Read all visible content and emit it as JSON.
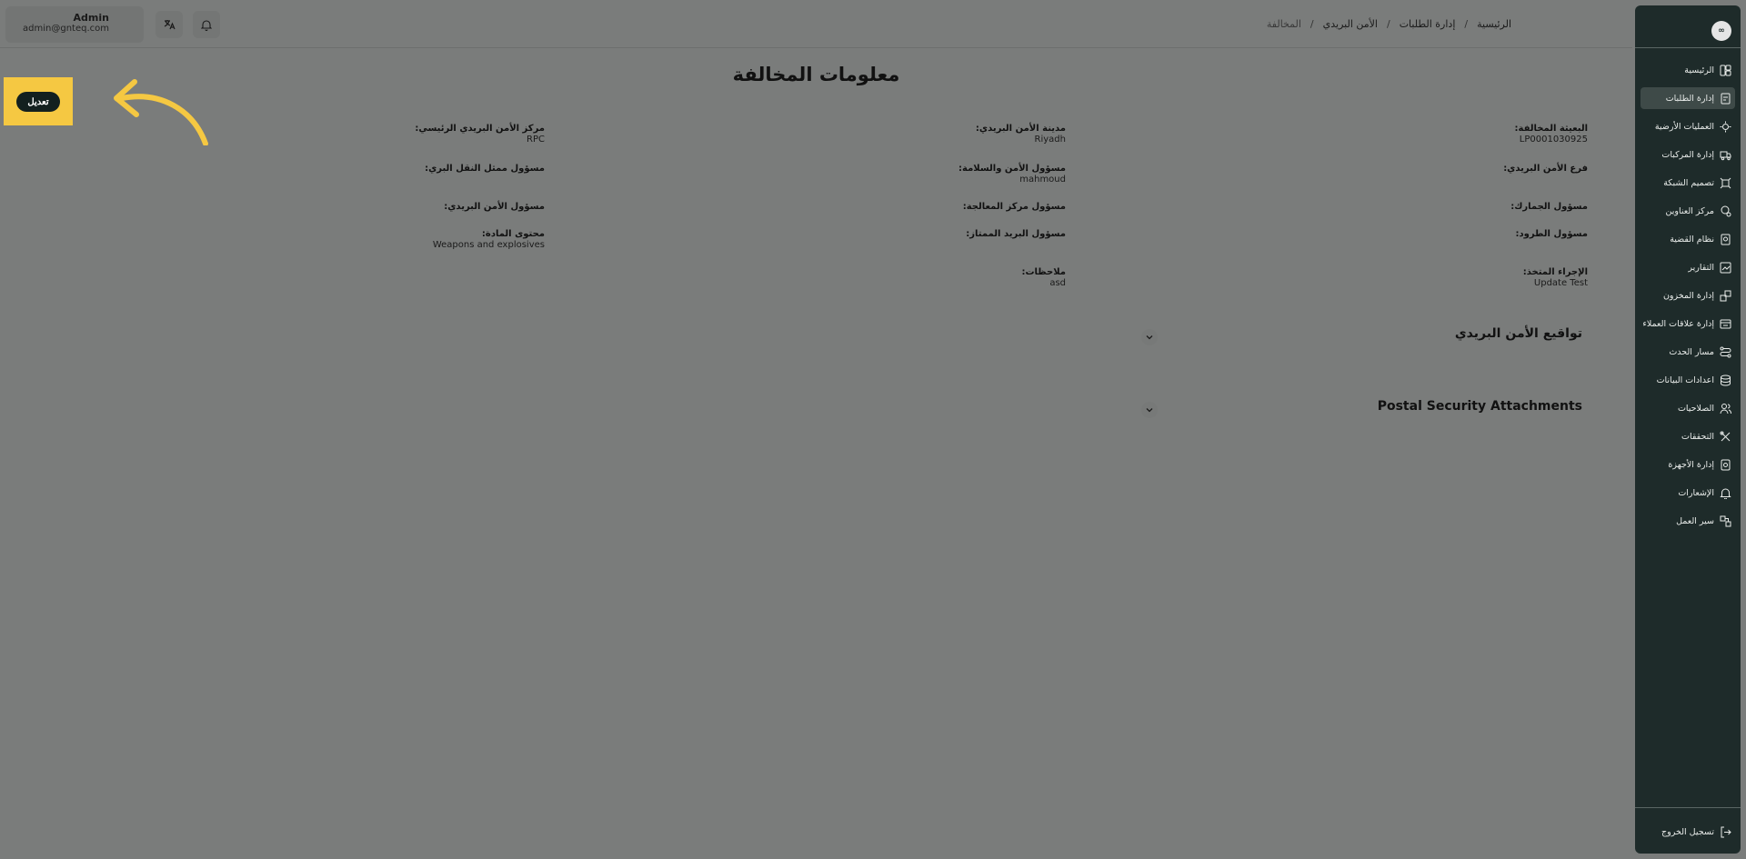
{
  "header": {
    "user_name": "Admin",
    "user_email": "admin@gnteq.com",
    "breadcrumb": [
      "الرئيسية",
      "إدارة الطلبات",
      "الأمن البريدي",
      "المخالفة"
    ],
    "translate_icon": "translate-icon",
    "bell_icon": "bell-icon"
  },
  "sidebar": {
    "logo_text": "∞",
    "items": [
      {
        "label": "الرئيسية",
        "icon": "dashboard-icon"
      },
      {
        "label": "إدارة الطلبات",
        "icon": "requests-icon"
      },
      {
        "label": "العمليات الأرضية",
        "icon": "ground-ops-icon"
      },
      {
        "label": "إدارة المركبات",
        "icon": "truck-icon"
      },
      {
        "label": "تصميم الشبكة",
        "icon": "network-icon"
      },
      {
        "label": "مركز العناوين",
        "icon": "location-icon"
      },
      {
        "label": "نظام القضية",
        "icon": "case-icon"
      },
      {
        "label": "التقارير",
        "icon": "reports-icon"
      },
      {
        "label": "إدارة المخزون",
        "icon": "inventory-icon"
      },
      {
        "label": "إدارة علاقات العملاء",
        "icon": "crm-icon"
      },
      {
        "label": "مسار الحدث",
        "icon": "route-icon"
      },
      {
        "label": "اعدادات البيانات",
        "icon": "database-icon"
      },
      {
        "label": "الصلاحيات",
        "icon": "users-icon"
      },
      {
        "label": "التحققات",
        "icon": "tools-icon"
      },
      {
        "label": "إدارة الأجهزة",
        "icon": "device-icon"
      },
      {
        "label": "الإشعارات",
        "icon": "bell-icon"
      },
      {
        "label": "سير العمل",
        "icon": "workflow-icon"
      }
    ],
    "logout_label": "تسجيل الخروج"
  },
  "main": {
    "title": "معلومات المخالفة",
    "edit_label": "تعديل",
    "fields": {
      "violation_entity": {
        "label": "البعيثة المخالفة:",
        "value": "LP0001030925"
      },
      "security_city": {
        "label": "مدينة الأمن البريدي:",
        "value": "Riyadh"
      },
      "main_center": {
        "label": "مركز الأمن البريدي الرئيسي:",
        "value": "RPC"
      },
      "security_branch": {
        "label": "فرع الأمن البريدي:",
        "value": ""
      },
      "safety_officer": {
        "label": "مسؤول الأمن والسلامة:",
        "value": "mahmoud"
      },
      "land_transport_officer": {
        "label": "مسؤول ممثل النقل البري:",
        "value": ""
      },
      "customs_officer": {
        "label": "مسؤول الجمارك:",
        "value": ""
      },
      "processing_officer": {
        "label": "مسؤول مركز المعالجة:",
        "value": ""
      },
      "security_officer": {
        "label": "مسؤول الأمن البريدي:",
        "value": ""
      },
      "parcels_officer": {
        "label": "مسؤول الطرود:",
        "value": ""
      },
      "premium_officer": {
        "label": "مسؤول البريد الممتاز:",
        "value": ""
      },
      "material_content": {
        "label": "محتوى المادة:",
        "value": "Weapons and explosives"
      },
      "action_taken": {
        "label": "الإجراء المتخذ:",
        "value": "Update Test"
      },
      "notes": {
        "label": "ملاحظات:",
        "value": "asd"
      }
    },
    "sections": [
      {
        "title": "تواقيع الأمن البريدي"
      },
      {
        "title": "Postal Security Attachments"
      }
    ]
  },
  "colors": {
    "overlay": "#7a7c7b",
    "sidebar": "#1e2b2a",
    "highlight": "#f5c842",
    "edit_button": "#13201f"
  }
}
